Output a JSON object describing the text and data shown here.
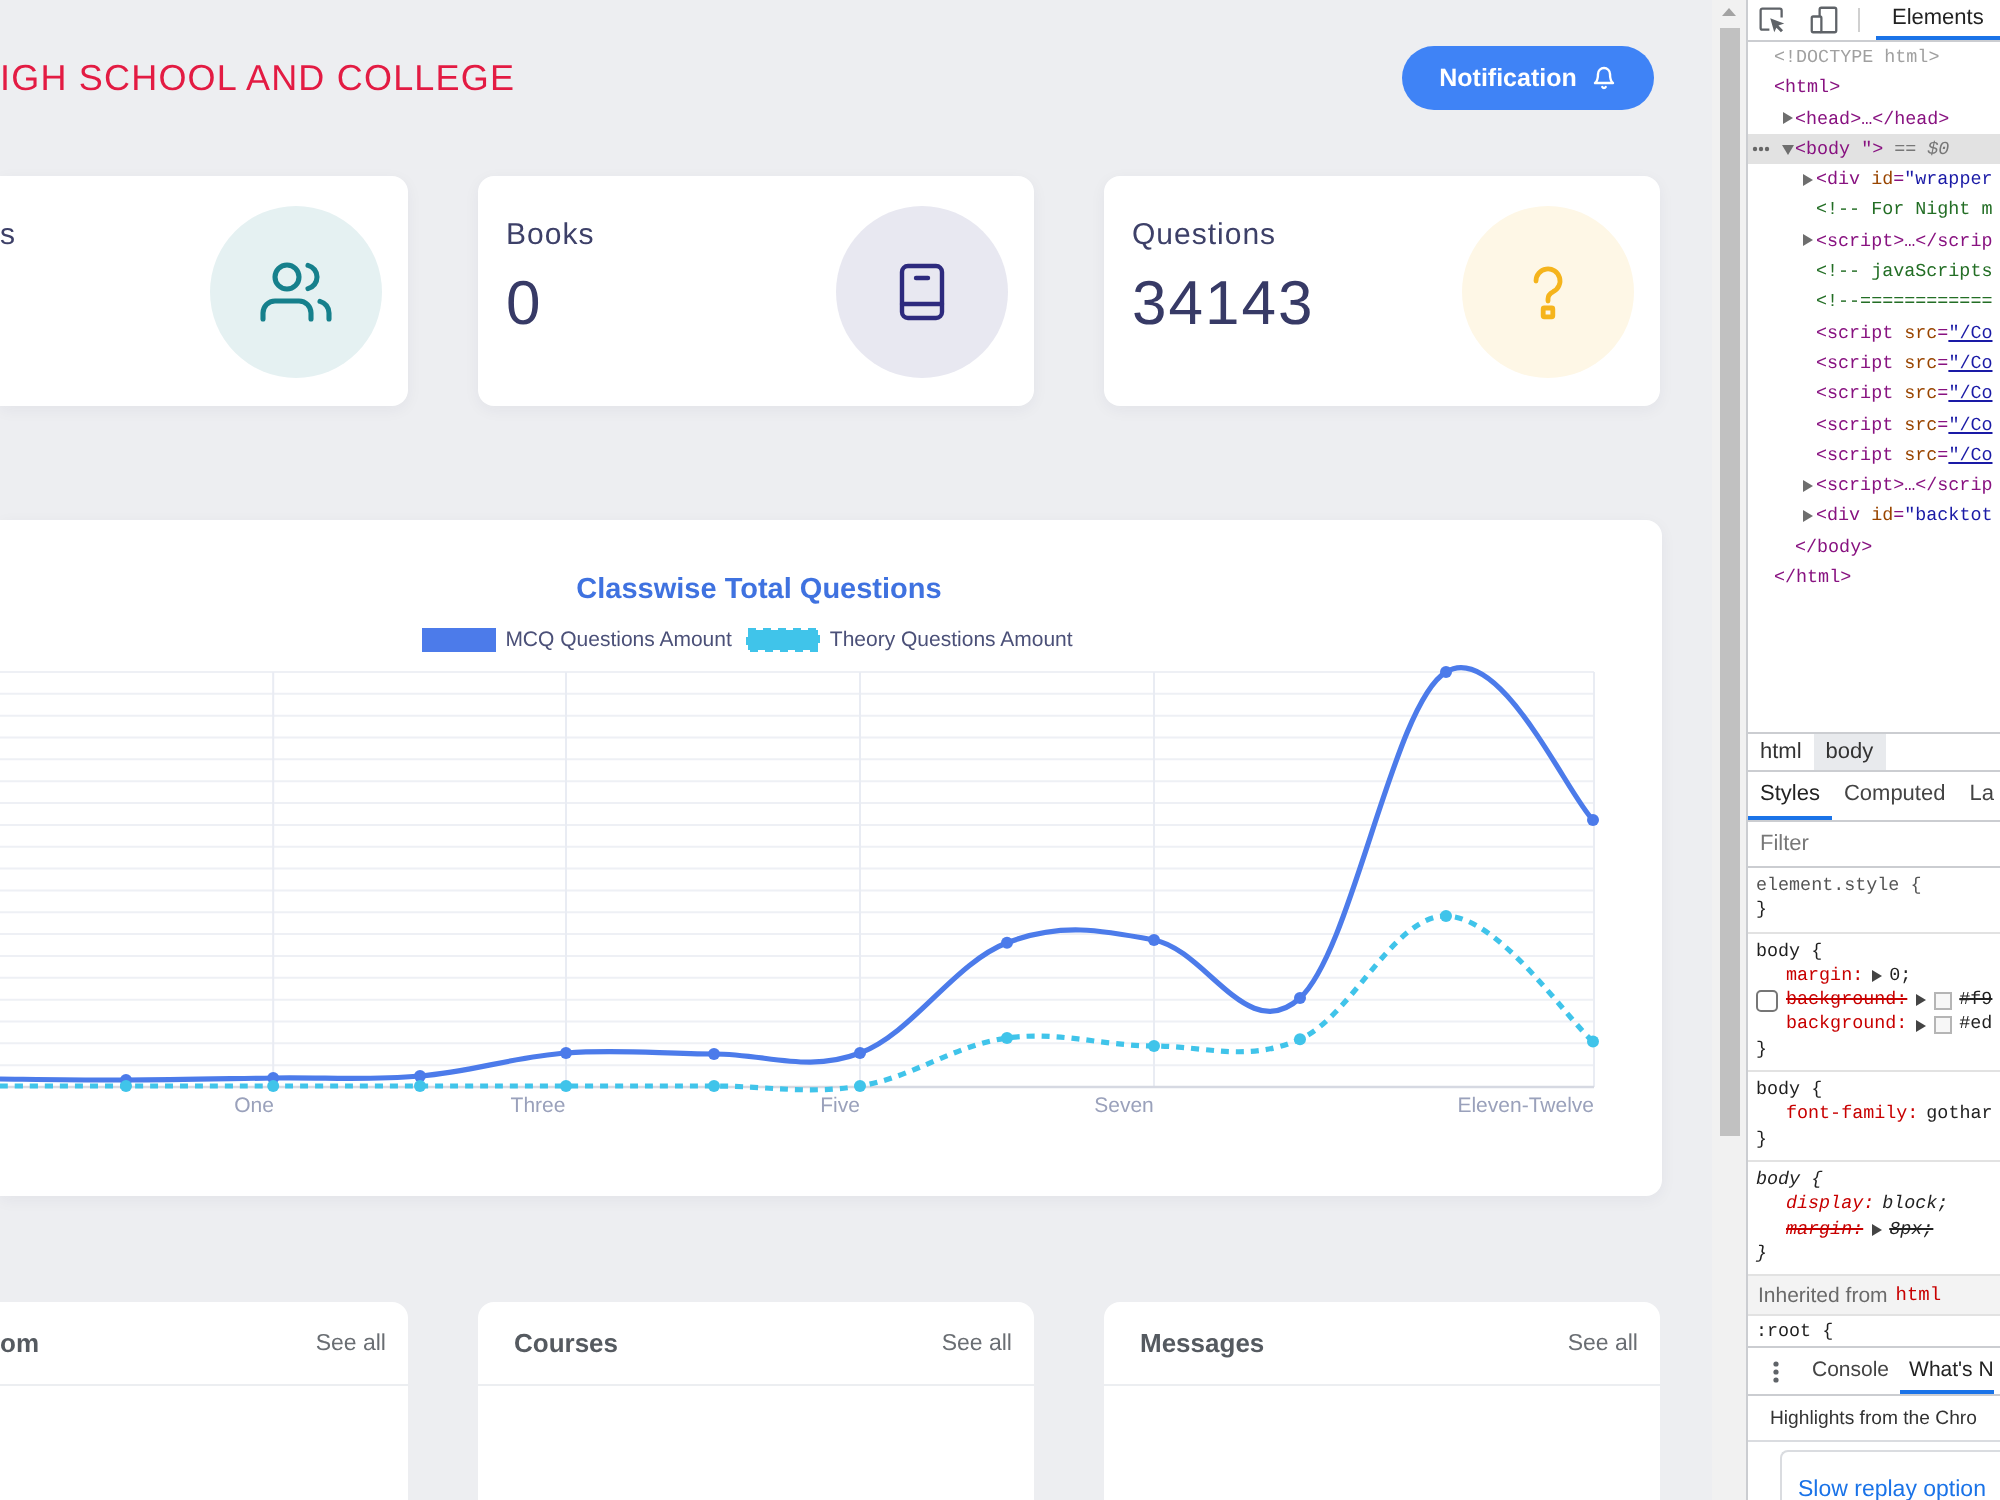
{
  "header": {
    "title": "IGH SCHOOL AND COLLEGE",
    "notification": {
      "label": "Notification"
    }
  },
  "stat_cards": [
    {
      "label": "s",
      "color": "#16808c"
    },
    {
      "label": "Books",
      "value": "0",
      "color": "#2d2a7e"
    },
    {
      "label": "Questions",
      "value": "34143",
      "color": "#f5b41c"
    }
  ],
  "chart": {
    "title": "Classwise Total Questions",
    "legend": [
      {
        "label": "MCQ Questions Amount",
        "color": "#4c7bea",
        "kind": "solid"
      },
      {
        "label": "Theory Questions Amount",
        "color": "#40c4ea",
        "kind": "dashed"
      }
    ],
    "x_labels": [
      "One",
      "Three",
      "Five",
      "Seven",
      "Eleven-Twelve"
    ]
  },
  "panels": [
    {
      "title": "om",
      "link": "See all"
    },
    {
      "title": "Courses",
      "link": "See all"
    },
    {
      "title": "Messages",
      "link": "See all"
    }
  ],
  "devtools": {
    "tabs": [
      {
        "label": "Elements",
        "selected": true
      }
    ],
    "dom_tree": [
      {
        "text": "<!DOCTYPE html>",
        "kind": "doctype",
        "selected": false
      },
      {
        "text": "<html>",
        "kind": "tag",
        "selected": false,
        "children": [
          {
            "text": "<head>…</head>",
            "kind": "tag",
            "selected": false,
            "expanded": false
          },
          {
            "text": "<body \"> == $0",
            "kind": "tag",
            "selected": true,
            "expanded": true,
            "children": [
              {
                "text": "<div id=\"wrapper",
                "kind": "tag",
                "selected": false,
                "expanded": false
              },
              {
                "text": "<!-- For Night m",
                "kind": "comment",
                "selected": false
              },
              {
                "text": "<script>…</scrip",
                "kind": "tag",
                "selected": false,
                "expanded": false
              },
              {
                "text": "<!-- javaScripts",
                "kind": "comment",
                "selected": false
              },
              {
                "text": "<!--============",
                "kind": "comment",
                "selected": false
              },
              {
                "text": "<script src=\"/Co",
                "kind": "link",
                "selected": false
              },
              {
                "text": "<script src=\"/Co",
                "kind": "link",
                "selected": false
              },
              {
                "text": "<script src=\"/Co",
                "kind": "link",
                "selected": false
              },
              {
                "text": "<script src=\"/Co",
                "kind": "link",
                "selected": false
              },
              {
                "text": "<script src=\"/Co",
                "kind": "link",
                "selected": false
              },
              {
                "text": "<script>…</scrip",
                "kind": "tag",
                "selected": false,
                "expanded": false
              },
              {
                "text": "<div id=\"backtot",
                "kind": "tag",
                "selected": false,
                "expanded": false
              }
            ],
            "closing": "</body>"
          }
        ],
        "closing": "</html>"
      }
    ],
    "breadcrumbs": [
      {
        "label": "html",
        "selected": false
      },
      {
        "label": "body",
        "selected": true
      }
    ],
    "styles_tabs": [
      {
        "label": "Styles",
        "selected": true
      },
      {
        "label": "Computed",
        "selected": false
      },
      {
        "label": "La",
        "selected": false
      }
    ],
    "filter": {
      "placeholder": "Filter"
    },
    "rules": [
      {
        "selector": "element.style {",
        "kind": "inline",
        "close": "}"
      },
      {
        "selector": "body {",
        "kind": "author",
        "declarations": [
          {
            "property": "margin:",
            "value": "0;",
            "expandable": true,
            "overridden": false
          },
          {
            "property": "background:",
            "value": "#f9",
            "expandable": true,
            "overridden": true,
            "swatch": true,
            "checkbox": {
              "checked": false
            }
          },
          {
            "property": "background:",
            "value": "#ed",
            "expandable": true,
            "overridden": false,
            "swatch": true
          }
        ],
        "close": "}"
      },
      {
        "selector": "body {",
        "kind": "author",
        "declarations": [
          {
            "property": "font-family:",
            "value": "gothar",
            "overridden": false
          }
        ],
        "close": "}"
      },
      {
        "selector": "body {",
        "kind": "user-agent",
        "declarations": [
          {
            "property": "display:",
            "value": "block;",
            "overridden": false
          },
          {
            "property": "margin:",
            "value": "8px;",
            "expandable": true,
            "overridden": true
          }
        ],
        "close": "}"
      }
    ],
    "inherited": {
      "label": "Inherited from",
      "source": "html"
    },
    "inherited_rules": [
      {
        "selector": ":root {",
        "kind": "author"
      }
    ],
    "drawer_tabs": [
      {
        "label": "Console",
        "selected": false
      },
      {
        "label": "What's N",
        "selected": true
      }
    ],
    "drawer_heading": "Highlights from the Chro",
    "drawer_link": "Slow replay option"
  }
}
